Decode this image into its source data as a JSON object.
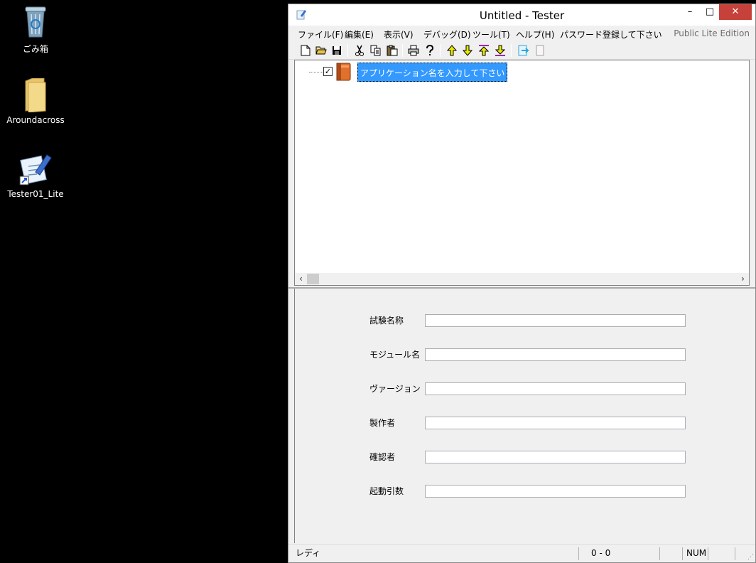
{
  "desktop": {
    "icons": [
      {
        "label": "ごみ箱",
        "icon": "recycle-bin-icon"
      },
      {
        "label": "Aroundacross",
        "icon": "folder-icon"
      },
      {
        "label": "Tester01_Lite",
        "icon": "app-shortcut-icon"
      }
    ]
  },
  "window": {
    "title": "Untitled - Tester",
    "controls": {
      "minimize": "–",
      "maximize": "□",
      "close": "✕"
    }
  },
  "menu": {
    "items": [
      "ファイル(F)",
      "編集(E)",
      "表示(V)",
      "デバッグ(D)",
      "ツール(T)",
      "ヘルプ(H)",
      "パスワード登録して下さい"
    ],
    "edition": "Public Lite Edition"
  },
  "toolbar": {
    "buttons": [
      "new-file-icon",
      "open-folder-icon",
      "save-icon",
      "cut-icon",
      "copy-icon",
      "paste-icon",
      "print-icon",
      "help-icon",
      "move-up-icon",
      "move-down-icon",
      "move-top-icon",
      "move-bottom-icon",
      "export-icon",
      "blank-icon"
    ]
  },
  "tree": {
    "node_label": "アプリケーション名を入力して下さい",
    "node_checked": true,
    "checkmark": "✓"
  },
  "scrollbar": {
    "left_arrow": "‹",
    "right_arrow": "›"
  },
  "form": {
    "fields": [
      {
        "label": "試験名称",
        "value": ""
      },
      {
        "label": "モジュール名",
        "value": ""
      },
      {
        "label": "ヴァージョン",
        "value": ""
      },
      {
        "label": "製作者",
        "value": ""
      },
      {
        "label": "確認者",
        "value": ""
      },
      {
        "label": "起動引数",
        "value": ""
      }
    ]
  },
  "status": {
    "message": "レディ",
    "position": "0 -    0",
    "num": "NUM"
  },
  "colors": {
    "selection": "#3399ff",
    "close_button": "#c7413b",
    "arrow_yellow": "#e8e800"
  }
}
